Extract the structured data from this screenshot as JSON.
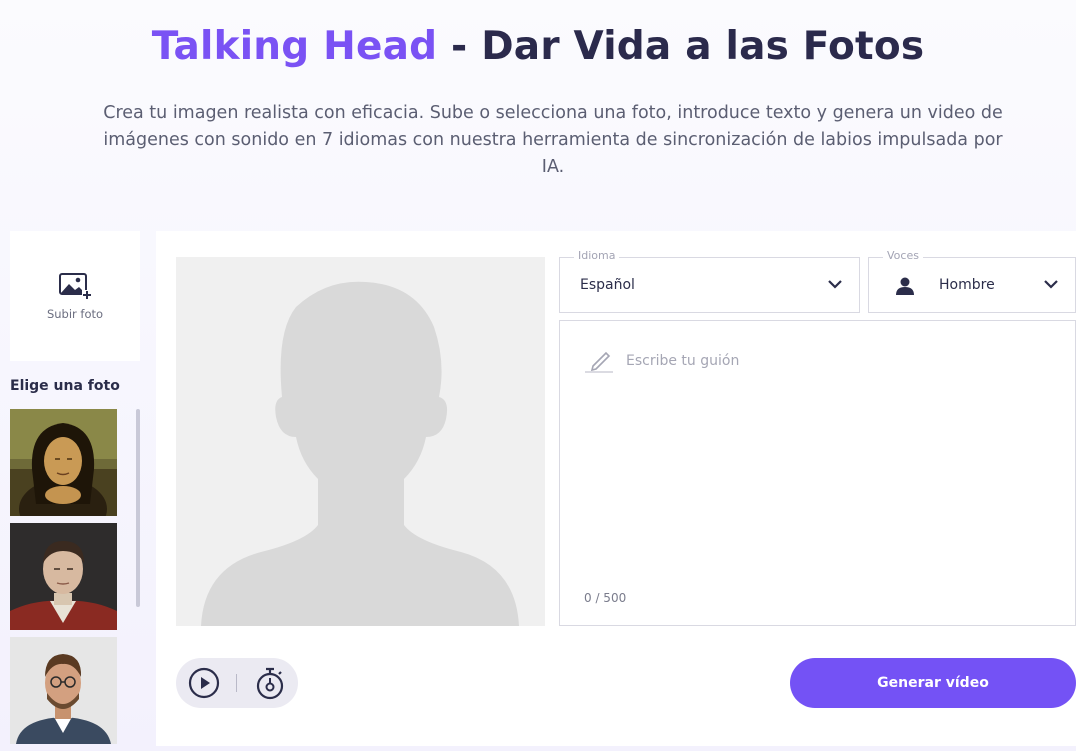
{
  "hero": {
    "title_accent": "Talking Head",
    "title_rest": " - Dar Vida a las Fotos",
    "subtitle": "Crea tu imagen realista con eficacia. Sube o selecciona una foto, introduce texto y genera un video de imágenes con sonido en 7 idiomas con nuestra herramienta de sincronización de labios impulsada por IA."
  },
  "sidebar": {
    "upload_label": "Subir foto",
    "choose_label": "Elige una foto",
    "photos": [
      {
        "subject": "mona-lisa-portrait"
      },
      {
        "subject": "napoleon-portrait"
      },
      {
        "subject": "man-with-glasses-photo"
      }
    ]
  },
  "language": {
    "legend": "Idioma",
    "value": "Español"
  },
  "voice": {
    "legend": "Voces",
    "value": "Hombre"
  },
  "script": {
    "placeholder": "Escribe tu guión",
    "counter": "0 / 500"
  },
  "actions": {
    "generate_label": "Generar vídeo"
  },
  "colors": {
    "accent": "#7a52f4",
    "button": "#7452f5",
    "title": "#2b2a4c"
  }
}
